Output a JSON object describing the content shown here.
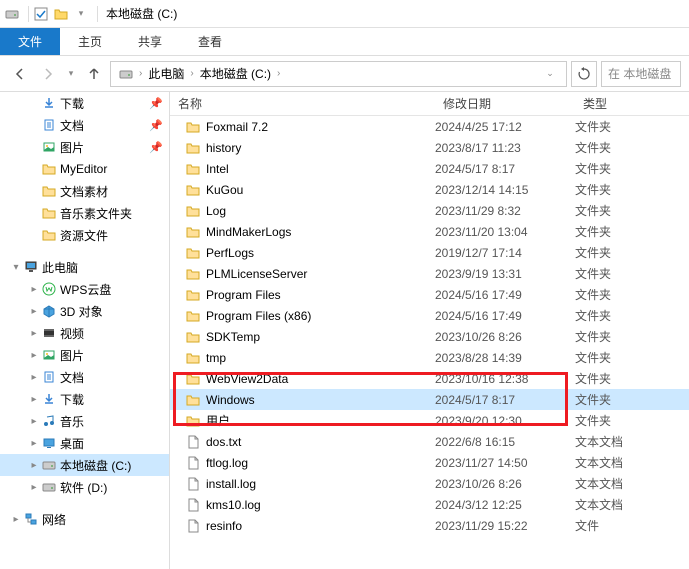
{
  "window": {
    "title": "本地磁盘 (C:)"
  },
  "ribbon": {
    "file": "文件",
    "tabs": [
      "主页",
      "共享",
      "查看"
    ]
  },
  "breadcrumb": {
    "root": "此电脑",
    "current": "本地磁盘 (C:)"
  },
  "search_placeholder": "在 本地磁盘",
  "columns": {
    "name": "名称",
    "date": "修改日期",
    "type": "类型"
  },
  "sidebar": {
    "quick": [
      {
        "label": "下载",
        "icon": "download",
        "pinned": true
      },
      {
        "label": "文档",
        "icon": "document",
        "pinned": true
      },
      {
        "label": "图片",
        "icon": "pictures",
        "pinned": true
      },
      {
        "label": "MyEditor",
        "icon": "folder",
        "pinned": false
      },
      {
        "label": "文档素材",
        "icon": "folder",
        "pinned": false
      },
      {
        "label": "音乐素文件夹",
        "icon": "folder",
        "pinned": false
      },
      {
        "label": "资源文件",
        "icon": "folder",
        "pinned": false
      }
    ],
    "this_pc_label": "此电脑",
    "this_pc": [
      {
        "label": "WPS云盘",
        "icon": "wps"
      },
      {
        "label": "3D 对象",
        "icon": "3d"
      },
      {
        "label": "视频",
        "icon": "video"
      },
      {
        "label": "图片",
        "icon": "pictures"
      },
      {
        "label": "文档",
        "icon": "document"
      },
      {
        "label": "下载",
        "icon": "download"
      },
      {
        "label": "音乐",
        "icon": "music"
      },
      {
        "label": "桌面",
        "icon": "desktop"
      },
      {
        "label": "本地磁盘 (C:)",
        "icon": "drive",
        "selected": true
      },
      {
        "label": "软件 (D:)",
        "icon": "drive"
      }
    ],
    "network_label": "网络"
  },
  "files": [
    {
      "name": "Foxmail 7.2",
      "date": "2024/4/25 17:12",
      "type": "文件夹",
      "icon": "folder"
    },
    {
      "name": "history",
      "date": "2023/8/17 11:23",
      "type": "文件夹",
      "icon": "folder"
    },
    {
      "name": "Intel",
      "date": "2024/5/17 8:17",
      "type": "文件夹",
      "icon": "folder"
    },
    {
      "name": "KuGou",
      "date": "2023/12/14 14:15",
      "type": "文件夹",
      "icon": "folder"
    },
    {
      "name": "Log",
      "date": "2023/11/29 8:32",
      "type": "文件夹",
      "icon": "folder"
    },
    {
      "name": "MindMakerLogs",
      "date": "2023/11/20 13:04",
      "type": "文件夹",
      "icon": "folder"
    },
    {
      "name": "PerfLogs",
      "date": "2019/12/7 17:14",
      "type": "文件夹",
      "icon": "folder"
    },
    {
      "name": "PLMLicenseServer",
      "date": "2023/9/19 13:31",
      "type": "文件夹",
      "icon": "folder"
    },
    {
      "name": "Program Files",
      "date": "2024/5/16 17:49",
      "type": "文件夹",
      "icon": "folder"
    },
    {
      "name": "Program Files (x86)",
      "date": "2024/5/16 17:49",
      "type": "文件夹",
      "icon": "folder"
    },
    {
      "name": "SDKTemp",
      "date": "2023/10/26 8:26",
      "type": "文件夹",
      "icon": "folder"
    },
    {
      "name": "tmp",
      "date": "2023/8/28 14:39",
      "type": "文件夹",
      "icon": "folder"
    },
    {
      "name": "WebView2Data",
      "date": "2023/10/16 12:38",
      "type": "文件夹",
      "icon": "folder"
    },
    {
      "name": "Windows",
      "date": "2024/5/17 8:17",
      "type": "文件夹",
      "icon": "folder",
      "selected": true
    },
    {
      "name": "用户",
      "date": "2023/9/20 12:30",
      "type": "文件夹",
      "icon": "folder"
    },
    {
      "name": "dos.txt",
      "date": "2022/6/8 16:15",
      "type": "文本文档",
      "icon": "file"
    },
    {
      "name": "ftlog.log",
      "date": "2023/11/27 14:50",
      "type": "文本文档",
      "icon": "file"
    },
    {
      "name": "install.log",
      "date": "2023/10/26 8:26",
      "type": "文本文档",
      "icon": "file"
    },
    {
      "name": "kms10.log",
      "date": "2024/3/12 12:25",
      "type": "文本文档",
      "icon": "file"
    },
    {
      "name": "resinfo",
      "date": "2023/11/29 15:22",
      "type": "文件",
      "icon": "file"
    }
  ],
  "highlight_row_index": 13
}
